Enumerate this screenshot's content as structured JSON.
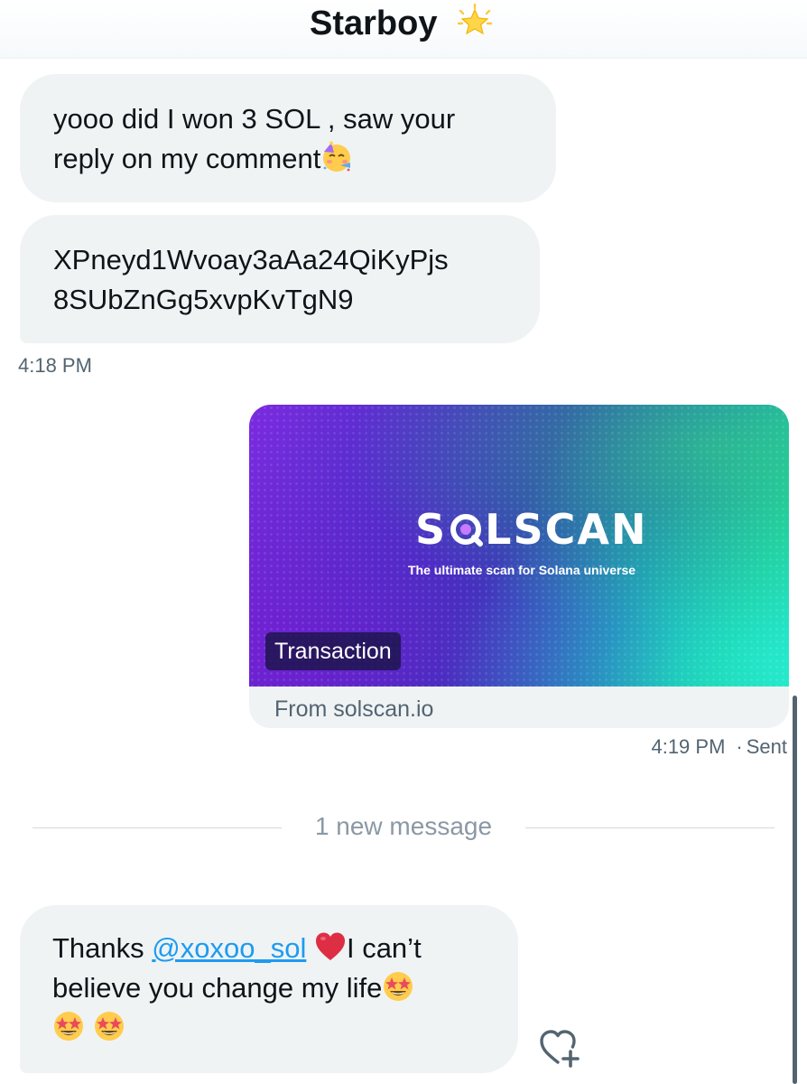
{
  "header": {
    "title": "Starboy",
    "title_icon": "glowing-star-icon"
  },
  "messages": [
    {
      "direction": "received",
      "text": "yooo did I won 3 SOL , saw your reply on my comment",
      "line1": "yooo did I won 3 SOL , saw your",
      "line2": "reply on my comment",
      "emoji": "partying-face-icon"
    },
    {
      "direction": "received",
      "line1": "XPneyd1Wvoay3aAa24QiKyPjs",
      "line2": "8SUbZnGg5xvpKvTgN9"
    }
  ],
  "received_timestamp": "4:18 PM",
  "link_card": {
    "brand": "SOLSCAN",
    "brand_prefix": "S",
    "brand_suffix": "LSCAN",
    "tagline": "The ultimate scan for Solana universe",
    "badge": "Transaction",
    "source": "From solscan.io",
    "colors": {
      "purple": "#7c2ae0",
      "blue": "#3038b8",
      "green": "#21e3c5"
    }
  },
  "sent_status": {
    "time": "4:19 PM",
    "separator": "·",
    "status": "Sent"
  },
  "divider": {
    "label": "1 new message"
  },
  "new_message": {
    "direction": "received",
    "prefix": "Thanks ",
    "mention": "@xoxoo_sol",
    "after_heart": "I can’t",
    "line2": "believe you change my life",
    "emojis": [
      "red-heart-icon",
      "star-struck-icon",
      "star-struck-icon",
      "star-struck-icon"
    ]
  },
  "actions": {
    "react_icon": "add-reaction-heart-icon"
  },
  "colors": {
    "bubble": "#eff3f4",
    "text": "#0f1419",
    "secondary": "#536471",
    "link": "#1d9bf0"
  }
}
